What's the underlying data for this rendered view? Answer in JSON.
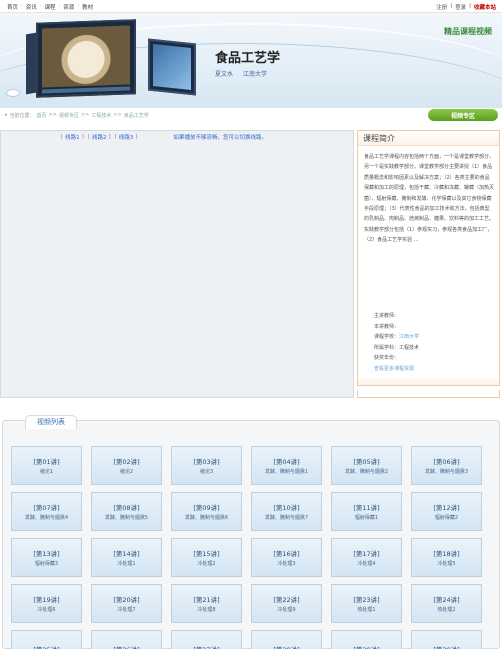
{
  "topnav": {
    "items": [
      "首页",
      "资讯",
      "课程",
      "资源",
      "教材"
    ]
  },
  "toplinks": {
    "register": "注册",
    "login": "登录",
    "favorite": "收藏本站"
  },
  "banner": {
    "title": "食品工艺学",
    "author": "夏文水",
    "school": "江南大学",
    "badge": "精品课程视频"
  },
  "breadcrumb": {
    "label": "当前位置：",
    "items": [
      "首页",
      "视频专区",
      "工程技术",
      "食品工艺学"
    ]
  },
  "video_tab": "视频专区",
  "player": {
    "lines": [
      "线路1",
      "线路2",
      "线路3"
    ],
    "hint": "如果播放不够流畅，您可以切换线路。"
  },
  "intro": {
    "heading": "课程简介",
    "text": "食品工艺学课程内容包括两个方面，一个是课堂教学部分，另一个是实践教学部分。课堂教学部分主要讲授（1）食品质量概念和影响因素以及解决方案；（2）各类主要的食品保藏和加工的原理，包括干藏、冷藏和冻藏、罐藏（加热灭菌）、辐射保藏、腌制和发酵、化学保藏以及其它食物保藏手段原理；（3）代表性食品的加工技术和方法，包括典型的乳制品、肉制品、焙烤制品、糖果、饮料等的加工工艺。实践教学部分包括（1）参观实习，参观各类食品加工厂，（2）食品工艺学实验 ...",
    "meta": {
      "lecturer_label": "主讲教师：",
      "lecturer": "",
      "teacher_label": "本讲教师：",
      "teacher": "",
      "school_label": "课程学校：",
      "school": "江南大学",
      "subject_label": "所属学科：",
      "subject": "工程技术",
      "award_label": "获奖年份：",
      "award": "",
      "more": "查看更多课程资源"
    }
  },
  "video_list": {
    "tab": "视频列表",
    "items": [
      {
        "num": "[第01讲]",
        "title": "绪论1"
      },
      {
        "num": "[第02讲]",
        "title": "绪论2"
      },
      {
        "num": "[第03讲]",
        "title": "绪论3"
      },
      {
        "num": "[第04讲]",
        "title": "发酵、腌制与烟熏1"
      },
      {
        "num": "[第05讲]",
        "title": "发酵、腌制与烟熏2"
      },
      {
        "num": "[第06讲]",
        "title": "发酵、腌制与烟熏3"
      },
      {
        "num": "[第07讲]",
        "title": "发酵、腌制与烟熏4"
      },
      {
        "num": "[第08讲]",
        "title": "发酵、腌制与烟熏5"
      },
      {
        "num": "[第09讲]",
        "title": "发酵、腌制与烟熏6"
      },
      {
        "num": "[第10讲]",
        "title": "发酵、腌制与烟熏7"
      },
      {
        "num": "[第11讲]",
        "title": "辐射保藏1"
      },
      {
        "num": "[第12讲]",
        "title": "辐射保藏2"
      },
      {
        "num": "[第13讲]",
        "title": "辐射保藏3"
      },
      {
        "num": "[第14讲]",
        "title": "冷处理1"
      },
      {
        "num": "[第15讲]",
        "title": "冷处理2"
      },
      {
        "num": "[第16讲]",
        "title": "冷处理3"
      },
      {
        "num": "[第17讲]",
        "title": "冷处理4"
      },
      {
        "num": "[第18讲]",
        "title": "冷处理5"
      },
      {
        "num": "[第19讲]",
        "title": "冷处理6"
      },
      {
        "num": "[第20讲]",
        "title": "冷处理7"
      },
      {
        "num": "[第21讲]",
        "title": "冷处理8"
      },
      {
        "num": "[第22讲]",
        "title": "冷处理9"
      },
      {
        "num": "[第23讲]",
        "title": "热处理1"
      },
      {
        "num": "[第24讲]",
        "title": "热处理2"
      },
      {
        "num": "[第25讲]",
        "title": ""
      },
      {
        "num": "[第26讲]",
        "title": ""
      },
      {
        "num": "[第27讲]",
        "title": ""
      },
      {
        "num": "[第28讲]",
        "title": ""
      },
      {
        "num": "[第29讲]",
        "title": ""
      },
      {
        "num": "[第30讲]",
        "title": ""
      }
    ]
  }
}
